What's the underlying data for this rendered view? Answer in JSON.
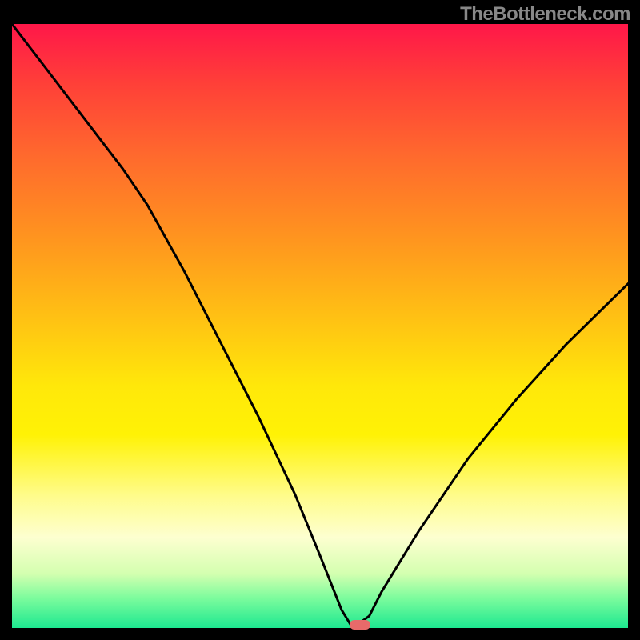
{
  "watermark": "TheBottleneck.com",
  "chart_data": {
    "type": "line",
    "title": "",
    "xlabel": "",
    "ylabel": "",
    "xlim": [
      0,
      100
    ],
    "ylim": [
      0,
      100
    ],
    "x": [
      0,
      6,
      12,
      18,
      22,
      28,
      34,
      40,
      46,
      50,
      53.5,
      55,
      56,
      58,
      60,
      66,
      74,
      82,
      90,
      100
    ],
    "values": [
      100,
      92,
      84,
      76,
      70,
      59,
      47,
      35,
      22,
      12,
      3,
      0.5,
      0.5,
      2,
      6,
      16,
      28,
      38,
      47,
      57
    ],
    "optimal_point": {
      "x": 56.5,
      "y": 0.5
    },
    "gradient_stops": [
      {
        "pos": 0,
        "color": "#ff1749"
      },
      {
        "pos": 10,
        "color": "#ff4038"
      },
      {
        "pos": 22,
        "color": "#ff6a2d"
      },
      {
        "pos": 35,
        "color": "#ff931f"
      },
      {
        "pos": 48,
        "color": "#ffbf14"
      },
      {
        "pos": 60,
        "color": "#ffe80a"
      },
      {
        "pos": 68,
        "color": "#fff205"
      },
      {
        "pos": 78,
        "color": "#fffc8a"
      },
      {
        "pos": 85,
        "color": "#fdffd0"
      },
      {
        "pos": 91,
        "color": "#d4ffb0"
      },
      {
        "pos": 95,
        "color": "#7dfc9d"
      },
      {
        "pos": 100,
        "color": "#1de890"
      }
    ]
  }
}
